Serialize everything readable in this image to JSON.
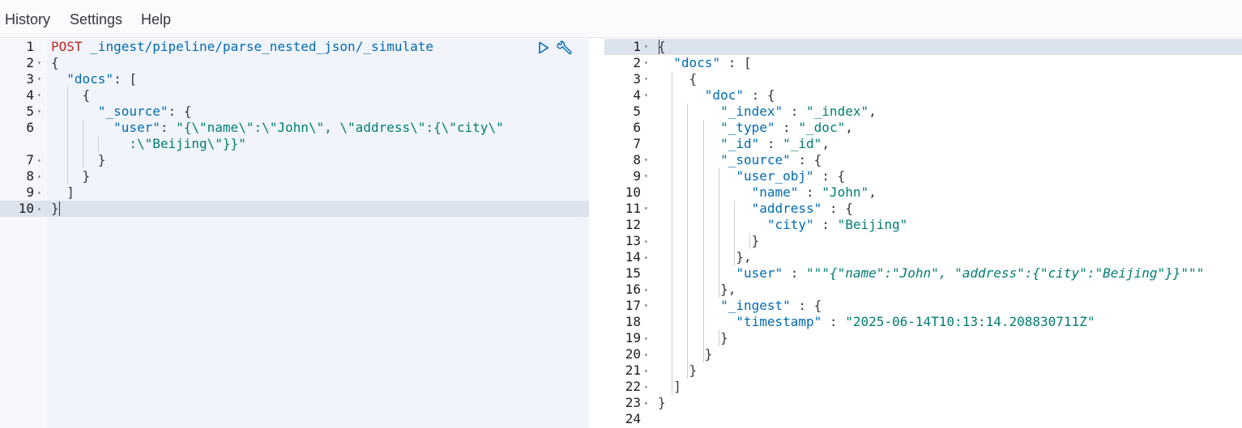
{
  "menu": {
    "items": [
      "History",
      "Settings",
      "Help"
    ]
  },
  "request_editor": {
    "lines": [
      {
        "num": "1",
        "fold": "",
        "tokens": [
          [
            "k",
            "POST"
          ],
          [
            "p",
            " "
          ],
          [
            "u",
            "_ingest/pipeline/parse_nested_json/_simulate"
          ]
        ]
      },
      {
        "num": "2",
        "fold": "▾",
        "tokens": [
          [
            "p",
            "{"
          ]
        ]
      },
      {
        "num": "3",
        "fold": "▾",
        "tokens": [
          [
            "p",
            "  "
          ],
          [
            "u",
            "\"docs\""
          ],
          [
            "p",
            ": ["
          ]
        ]
      },
      {
        "num": "4",
        "fold": "▾",
        "tokens": [
          [
            "p",
            "    {"
          ]
        ]
      },
      {
        "num": "5",
        "fold": "▾",
        "tokens": [
          [
            "p",
            "      "
          ],
          [
            "u",
            "\"_source\""
          ],
          [
            "p",
            ": {"
          ]
        ]
      },
      {
        "num": "6",
        "fold": "",
        "tokens": [
          [
            "p",
            "        "
          ],
          [
            "u",
            "\"user\""
          ],
          [
            "p",
            ": "
          ],
          [
            "v",
            "\"{\\\"name\\\":\\\"John\\\", \\\"address\\\":{\\\"city\\\""
          ]
        ]
      },
      {
        "num": "",
        "fold": "",
        "tokens": [
          [
            "v",
            "          :\\\"Beijing\\\"}}\""
          ]
        ]
      },
      {
        "num": "7",
        "fold": "▴",
        "tokens": [
          [
            "p",
            "      }"
          ]
        ]
      },
      {
        "num": "8",
        "fold": "▴",
        "tokens": [
          [
            "p",
            "    }"
          ]
        ]
      },
      {
        "num": "9",
        "fold": "▴",
        "tokens": [
          [
            "p",
            "  ]"
          ]
        ]
      },
      {
        "num": "10",
        "fold": "▴",
        "tokens": [
          [
            "p",
            "}"
          ]
        ]
      }
    ]
  },
  "response_editor": {
    "lines": [
      {
        "num": "1",
        "fold": "▾",
        "tokens": [
          [
            "p",
            "{"
          ]
        ]
      },
      {
        "num": "2",
        "fold": "▾",
        "tokens": [
          [
            "p",
            "  "
          ],
          [
            "u",
            "\"docs\""
          ],
          [
            "p",
            " : ["
          ]
        ]
      },
      {
        "num": "3",
        "fold": "▾",
        "tokens": [
          [
            "p",
            "    {"
          ]
        ]
      },
      {
        "num": "4",
        "fold": "▾",
        "tokens": [
          [
            "p",
            "      "
          ],
          [
            "u",
            "\"doc\""
          ],
          [
            "p",
            " : {"
          ]
        ]
      },
      {
        "num": "5",
        "fold": "",
        "tokens": [
          [
            "p",
            "        "
          ],
          [
            "u",
            "\"_index\""
          ],
          [
            "p",
            " : "
          ],
          [
            "v",
            "\"_index\""
          ],
          [
            "p",
            ","
          ]
        ]
      },
      {
        "num": "6",
        "fold": "",
        "tokens": [
          [
            "p",
            "        "
          ],
          [
            "u",
            "\"_type\""
          ],
          [
            "p",
            " : "
          ],
          [
            "v",
            "\"_doc\""
          ],
          [
            "p",
            ","
          ]
        ]
      },
      {
        "num": "7",
        "fold": "",
        "tokens": [
          [
            "p",
            "        "
          ],
          [
            "u",
            "\"_id\""
          ],
          [
            "p",
            " : "
          ],
          [
            "v",
            "\"_id\""
          ],
          [
            "p",
            ","
          ]
        ]
      },
      {
        "num": "8",
        "fold": "▾",
        "tokens": [
          [
            "p",
            "        "
          ],
          [
            "u",
            "\"_source\""
          ],
          [
            "p",
            " : {"
          ]
        ]
      },
      {
        "num": "9",
        "fold": "▾",
        "tokens": [
          [
            "p",
            "          "
          ],
          [
            "u",
            "\"user_obj\""
          ],
          [
            "p",
            " : {"
          ]
        ]
      },
      {
        "num": "10",
        "fold": "",
        "tokens": [
          [
            "p",
            "            "
          ],
          [
            "u",
            "\"name\""
          ],
          [
            "p",
            " : "
          ],
          [
            "v",
            "\"John\""
          ],
          [
            "p",
            ","
          ]
        ]
      },
      {
        "num": "11",
        "fold": "▾",
        "tokens": [
          [
            "p",
            "            "
          ],
          [
            "u",
            "\"address\""
          ],
          [
            "p",
            " : {"
          ]
        ]
      },
      {
        "num": "12",
        "fold": "",
        "tokens": [
          [
            "p",
            "              "
          ],
          [
            "u",
            "\"city\""
          ],
          [
            "p",
            " : "
          ],
          [
            "v",
            "\"Beijing\""
          ]
        ]
      },
      {
        "num": "13",
        "fold": "▴",
        "tokens": [
          [
            "p",
            "            }"
          ]
        ]
      },
      {
        "num": "14",
        "fold": "▴",
        "tokens": [
          [
            "p",
            "          },"
          ]
        ]
      },
      {
        "num": "15",
        "fold": "",
        "tokens": [
          [
            "p",
            "          "
          ],
          [
            "u",
            "\"user\""
          ],
          [
            "p",
            " : "
          ],
          [
            "v",
            "\"\"\""
          ],
          [
            "i",
            "{\"name\":\"John\", \"address\":{\"city\":\"Beijing\"}}"
          ],
          [
            "v",
            "\"\"\""
          ]
        ]
      },
      {
        "num": "16",
        "fold": "▴",
        "tokens": [
          [
            "p",
            "        },"
          ]
        ]
      },
      {
        "num": "17",
        "fold": "▾",
        "tokens": [
          [
            "p",
            "        "
          ],
          [
            "u",
            "\"_ingest\""
          ],
          [
            "p",
            " : {"
          ]
        ]
      },
      {
        "num": "18",
        "fold": "",
        "tokens": [
          [
            "p",
            "          "
          ],
          [
            "u",
            "\"timestamp\""
          ],
          [
            "p",
            " : "
          ],
          [
            "v",
            "\"2025-06-14T10:13:14.208830711Z\""
          ]
        ]
      },
      {
        "num": "19",
        "fold": "▴",
        "tokens": [
          [
            "p",
            "        }"
          ]
        ]
      },
      {
        "num": "20",
        "fold": "▴",
        "tokens": [
          [
            "p",
            "      }"
          ]
        ]
      },
      {
        "num": "21",
        "fold": "▴",
        "tokens": [
          [
            "p",
            "    }"
          ]
        ]
      },
      {
        "num": "22",
        "fold": "▴",
        "tokens": [
          [
            "p",
            "  ]"
          ]
        ]
      },
      {
        "num": "23",
        "fold": "▴",
        "tokens": [
          [
            "p",
            "}"
          ]
        ]
      },
      {
        "num": "24",
        "fold": "",
        "tokens": []
      }
    ]
  },
  "toolbar": {
    "run_icon": "play-icon",
    "settings_icon": "wrench-icon"
  }
}
